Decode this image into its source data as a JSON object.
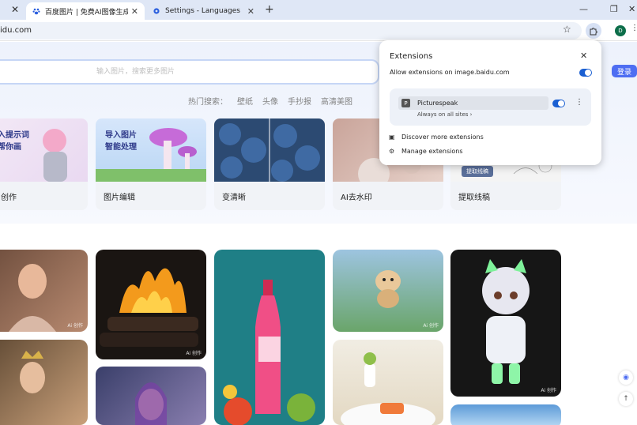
{
  "tabs": [
    {
      "title": "百度图片 | 免费AI图像生成工具",
      "active": true
    },
    {
      "title": "Settings - Languages",
      "active": false
    }
  ],
  "toolbar": {
    "url": "idu.com"
  },
  "profile": {
    "initial": "D"
  },
  "search": {
    "placeholder": "输入图片，搜索更多图片"
  },
  "header": {
    "login_label": "登录"
  },
  "hot": {
    "label": "热门搜索：",
    "items": [
      "壁纸",
      "头像",
      "手抄报",
      "高清美图"
    ]
  },
  "features": [
    {
      "label": "创作",
      "overlay": "入提示词\n帮你画"
    },
    {
      "label": "图片编辑",
      "overlay": "导入图片\n智能处理"
    },
    {
      "label": "变清晰"
    },
    {
      "label": "AI去水印"
    },
    {
      "label": "提取线稿",
      "tag": "提取线稿"
    }
  ],
  "watermark": "Ai 创作",
  "popup": {
    "title": "Extensions",
    "allow_text": "Allow extensions on image.baidu.com",
    "extension": {
      "name": "Picturespeak",
      "logo": "P",
      "access": "Always on all sites"
    },
    "discover": "Discover more extensions",
    "manage": "Manage extensions"
  },
  "colors": {
    "accent": "#1a5fd2",
    "login": "#4e6ef2"
  }
}
